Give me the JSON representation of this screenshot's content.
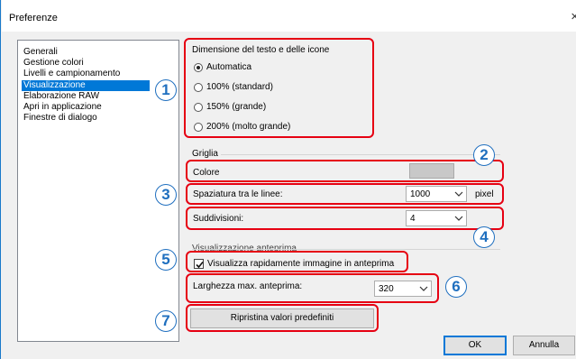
{
  "window": {
    "title": "Preferenze",
    "close_glyph": "×"
  },
  "categories": [
    {
      "label": "Generali"
    },
    {
      "label": "Gestione colori"
    },
    {
      "label": "Livelli e campionamento"
    },
    {
      "label": "Visualizzazione",
      "selected": true
    },
    {
      "label": "Elaborazione RAW"
    },
    {
      "label": "Apri in applicazione"
    },
    {
      "label": "Finestre di dialogo"
    }
  ],
  "text_size": {
    "heading": "Dimensione del testo e delle icone",
    "options": [
      {
        "label": "Automatica",
        "selected": true
      },
      {
        "label": "100% (standard)"
      },
      {
        "label": "150% (grande)"
      },
      {
        "label": "200% (molto grande)"
      }
    ]
  },
  "grid": {
    "heading": "Griglia",
    "color_label": "Colore",
    "color_value": "#c8c8c8",
    "spacing_label": "Spaziatura tra le linee:",
    "spacing_value": "1000",
    "spacing_unit": "pixel",
    "subdivisions_label": "Suddivisioni:",
    "subdivisions_value": "4"
  },
  "preview": {
    "heading_partial": "Visualizzazione anteprima",
    "quick_preview_label": "Visualizza rapidamente immagine in anteprima",
    "quick_preview_checked": true,
    "max_width_label": "Larghezza max. anteprima:",
    "max_width_value": "320"
  },
  "buttons": {
    "reset": "Ripristina valori predefiniti",
    "ok": "OK",
    "cancel": "Annulla"
  },
  "callouts": [
    "1",
    "2",
    "3",
    "4",
    "5",
    "6",
    "7"
  ],
  "colors": {
    "highlight_box": "#e60012",
    "callout": "#1f6fbf",
    "selection": "#0078d7"
  }
}
